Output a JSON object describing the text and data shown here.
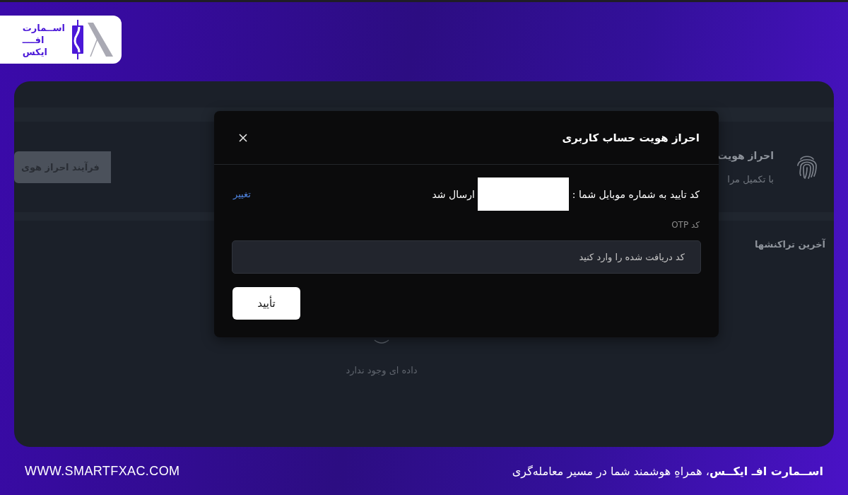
{
  "logo": {
    "lines": [
      "اســمارت",
      "افــــ",
      "ایکس"
    ]
  },
  "background_page": {
    "section": {
      "title": "احراز هویت",
      "subtitle": "با تکمیل مرا",
      "button": "فرآیند احراز هوی"
    },
    "transactions_title": "آخرین تراکنشها",
    "empty_state": "داده ای وجود ندارد"
  },
  "dialog": {
    "title": "احراز هویت حساب کاربری",
    "message_before": "کد تایید به شماره موبایل شما :",
    "message_after": "ارسال شد",
    "change_link": "تغییر",
    "otp_label": "کد OTP",
    "otp_field": {
      "placeholder": "کد دریافت شده را وارد کنید"
    },
    "confirm_button": "تأیید"
  },
  "footer": {
    "website": "WWW.SMARTFXAC.COM",
    "tagline": "**اســمارت افـ ایکــس**، همراهِ هوشمند شما در مسیر معامله‌گری"
  }
}
